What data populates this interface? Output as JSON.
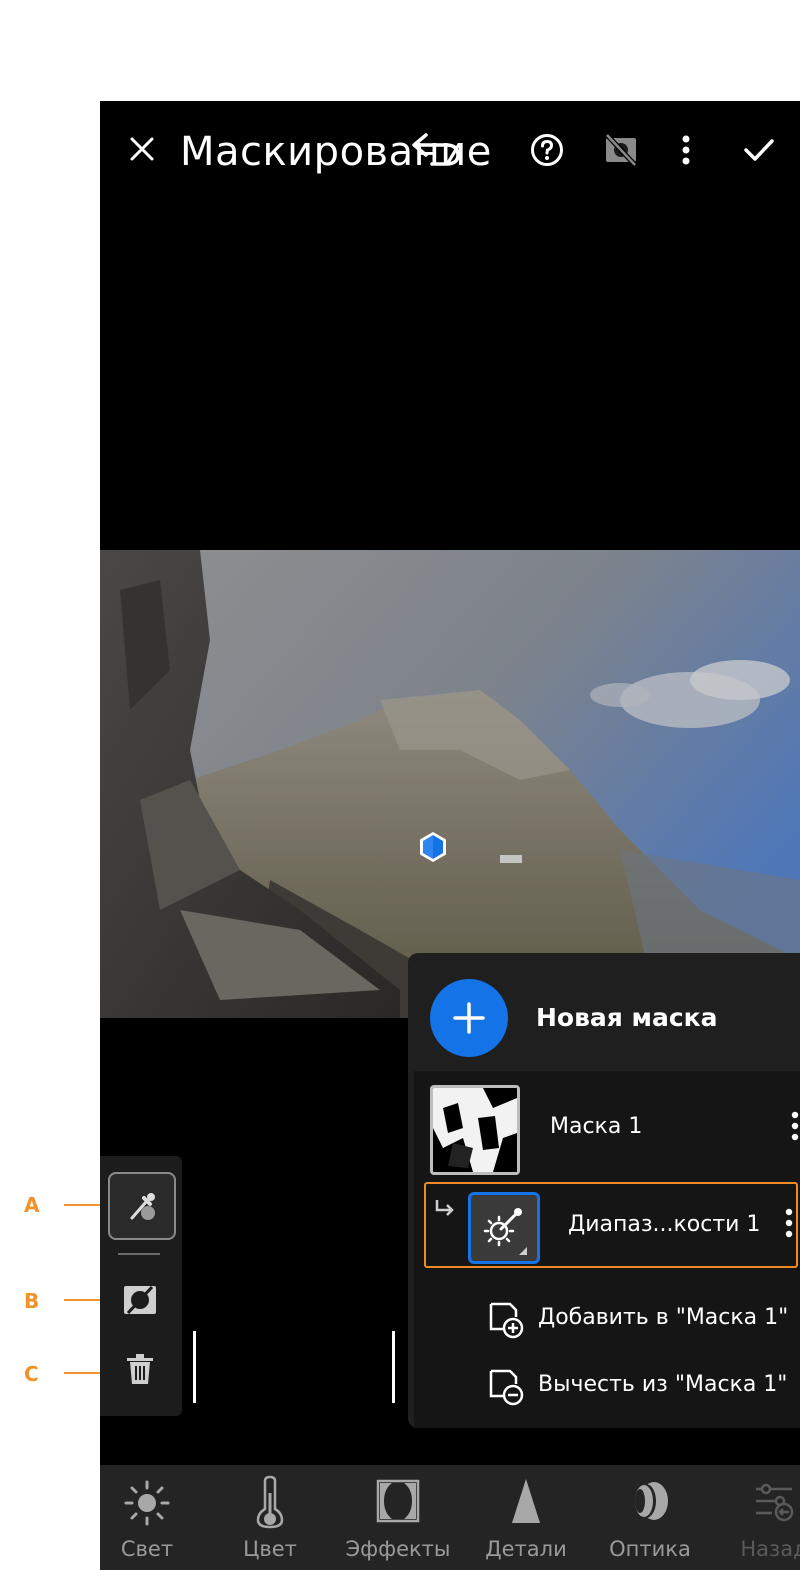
{
  "header": {
    "title": "Маскирование",
    "close_icon": "close-icon",
    "undo_icon": "undo-icon",
    "help_icon": "help-icon",
    "mask_overlay_icon": "mask-overlay-off-icon",
    "more_icon": "more-vertical-icon",
    "confirm_icon": "checkmark-icon"
  },
  "callouts": [
    {
      "letter": "A"
    },
    {
      "letter": "B"
    },
    {
      "letter": "C"
    }
  ],
  "side_tools": {
    "tools": [
      "eyedropper-icon",
      "invert-mask-icon",
      "trash-icon"
    ]
  },
  "mask_panel": {
    "new_mask_label": "Новая маска",
    "masks": [
      {
        "name": "Маска 1"
      },
      {
        "name": "Диапаз...кости 1"
      }
    ],
    "actions": [
      {
        "label": "Добавить в \"Маска 1\""
      },
      {
        "label": "Вычесть из \"Маска 1\""
      }
    ]
  },
  "bottom_nav": {
    "items": [
      {
        "label": "Свет",
        "icon": "sun-icon"
      },
      {
        "label": "Цвет",
        "icon": "thermometer-icon"
      },
      {
        "label": "Эффекты",
        "icon": "vignette-icon"
      },
      {
        "label": "Детали",
        "icon": "triangle-icon"
      },
      {
        "label": "Оптика",
        "icon": "lens-icon"
      },
      {
        "label": "Назад",
        "icon": "sliders-back-icon"
      }
    ]
  },
  "colors": {
    "accent_blue": "#1473e6",
    "callout_orange": "#f0932b",
    "selection_orange": "#f08a24"
  }
}
